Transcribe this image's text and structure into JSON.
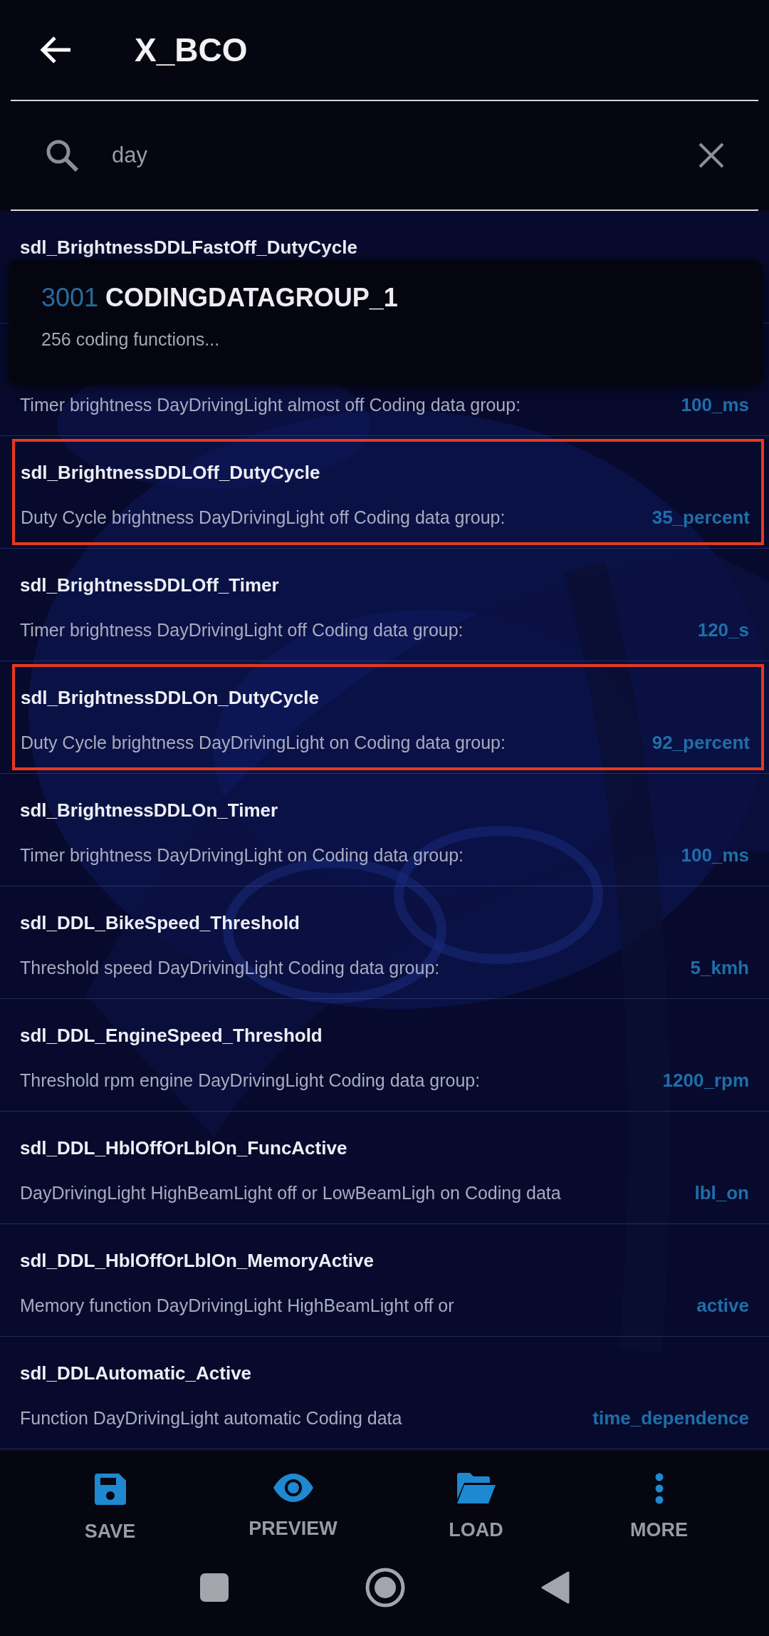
{
  "header": {
    "title": "X_BCO"
  },
  "search": {
    "value": "day"
  },
  "popup": {
    "number": "3001",
    "name": "CODINGDATAGROUP_1",
    "subtitle": "256 coding functions..."
  },
  "rows": [
    {
      "title": "sdl_BrightnessDDLFastOff_DutyCycle",
      "highlighted": false
    },
    {
      "description": "Timer brightness DayDrivingLight almost off Coding data group:",
      "value": "100_ms",
      "highlighted": false
    },
    {
      "title": "sdl_BrightnessDDLOff_DutyCycle",
      "description": "Duty Cycle brightness DayDrivingLight off Coding data group:",
      "value": "35_percent",
      "highlighted": true
    },
    {
      "title": "sdl_BrightnessDDLOff_Timer",
      "description": "Timer brightness DayDrivingLight off Coding data group:",
      "value": "120_s",
      "highlighted": false
    },
    {
      "title": "sdl_BrightnessDDLOn_DutyCycle",
      "description": "Duty Cycle brightness DayDrivingLight on Coding data group:",
      "value": "92_percent",
      "highlighted": true
    },
    {
      "title": "sdl_BrightnessDDLOn_Timer",
      "description": "Timer brightness DayDrivingLight on Coding data group:",
      "value": "100_ms",
      "highlighted": false
    },
    {
      "title": "sdl_DDL_BikeSpeed_Threshold",
      "description": "Threshold speed DayDrivingLight Coding data group:",
      "value": "5_kmh",
      "highlighted": false
    },
    {
      "title": "sdl_DDL_EngineSpeed_Threshold",
      "description": "Threshold rpm engine DayDrivingLight Coding data group:",
      "value": "1200_rpm",
      "highlighted": false
    },
    {
      "title": "sdl_DDL_HblOffOrLblOn_FuncActive",
      "description": "DayDrivingLight HighBeamLight off or LowBeamLigh on Coding data",
      "value": "lbl_on",
      "highlighted": false
    },
    {
      "title": "sdl_DDL_HblOffOrLblOn_MemoryActive",
      "description": "Memory function DayDrivingLight HighBeamLight off or",
      "value": "active",
      "highlighted": false
    },
    {
      "title": "sdl_DDLAutomatic_Active",
      "description": "Function DayDrivingLight automatic Coding data",
      "value": "time_dependence",
      "highlighted": false
    }
  ],
  "bottom_nav": [
    {
      "kind": "save",
      "label": "SAVE"
    },
    {
      "kind": "preview",
      "label": "PREVIEW"
    },
    {
      "kind": "load",
      "label": "LOAD"
    },
    {
      "kind": "more",
      "label": "MORE"
    }
  ]
}
